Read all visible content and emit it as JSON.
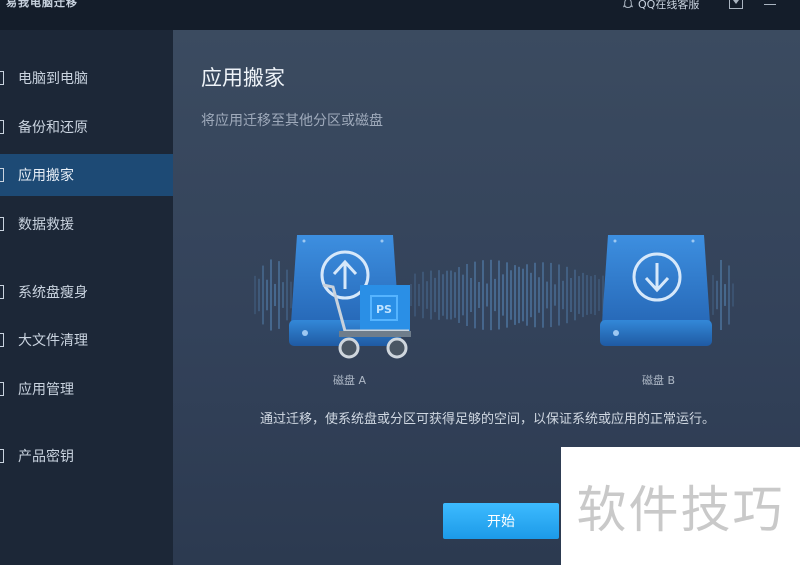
{
  "window": {
    "app_title": "易我电脑迁移",
    "qq_service": "QQ在线客服"
  },
  "sidebar": {
    "items": [
      {
        "label": "电脑到电脑"
      },
      {
        "label": "备份和还原"
      },
      {
        "label": "应用搬家"
      },
      {
        "label": "数据救援"
      },
      {
        "label": "系统盘瘦身"
      },
      {
        "label": "大文件清理"
      },
      {
        "label": "应用管理"
      },
      {
        "label": "产品密钥"
      }
    ],
    "active": "应用搬家"
  },
  "main": {
    "title": "应用搬家",
    "subtitle": "将应用迁移至其他分区或磁盘",
    "disk_a_label": "磁盘 A",
    "disk_b_label": "磁盘 B",
    "badge_text": "PS",
    "description": "通过迁移，使系统盘或分区可获得足够的空间，以保证系统或应用的正常运行。",
    "start_label": "开始"
  },
  "watermark": "软件技巧",
  "colors": {
    "accent": "#1c9ae8",
    "active_sidebar": "#1d4a75",
    "disk_blue": "#2f7fd0"
  },
  "icons": [
    "qq-icon",
    "dropdown-icon",
    "minimize-icon",
    "upload-arrow-icon",
    "download-arrow-icon",
    "cart-icon",
    "sound-wave-icon"
  ]
}
